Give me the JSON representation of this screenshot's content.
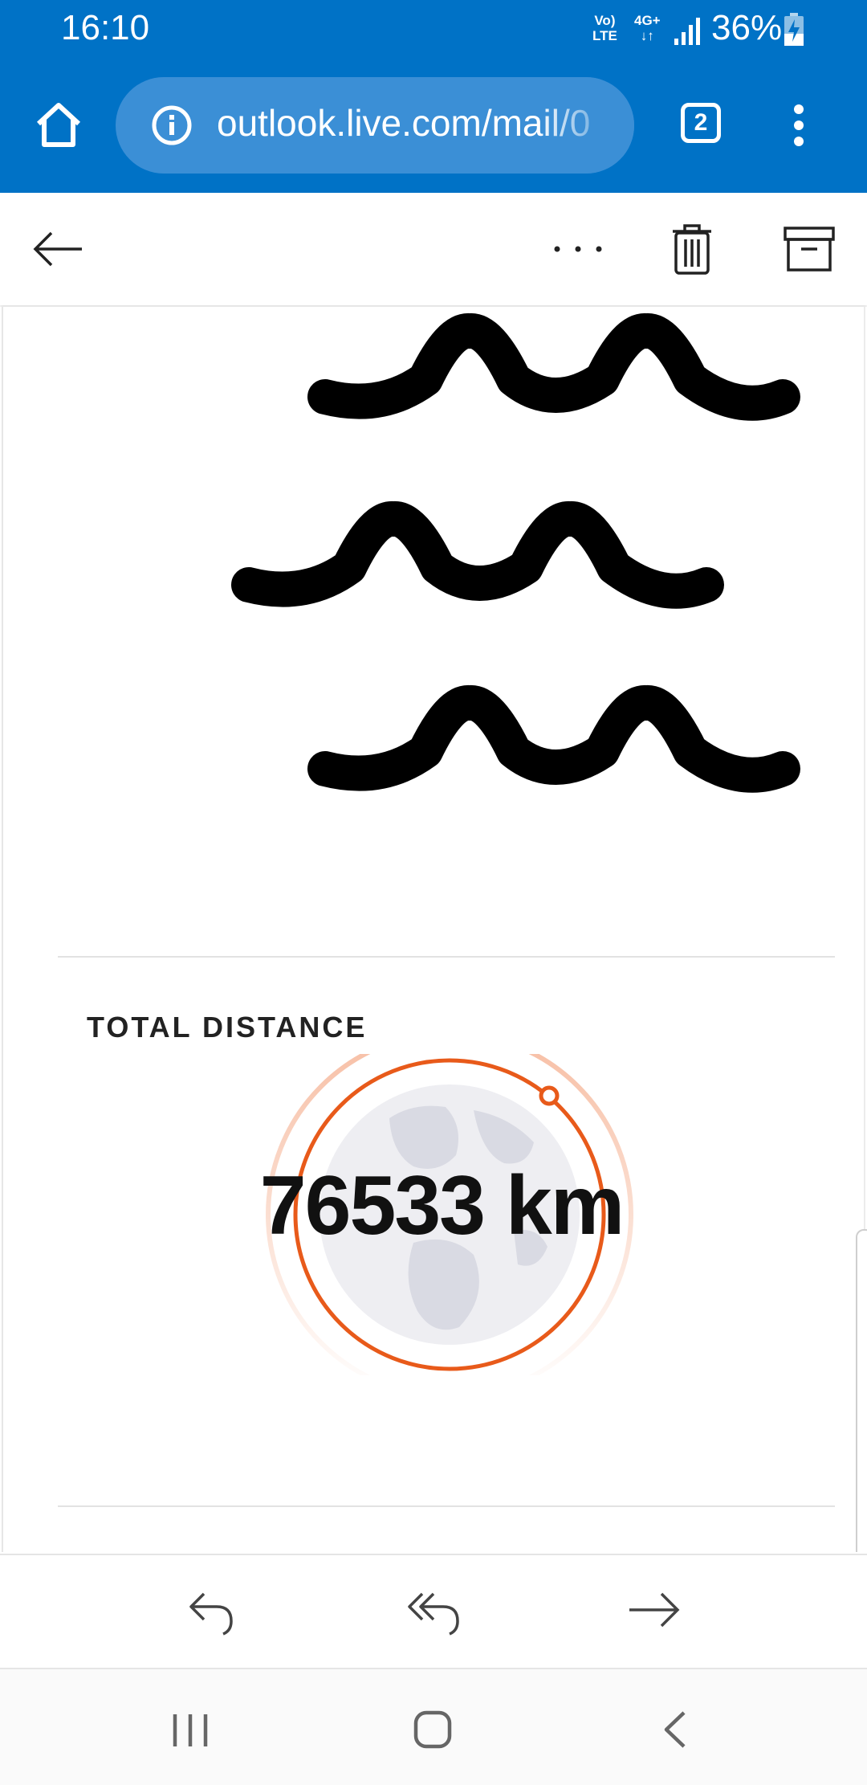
{
  "status_bar": {
    "time": "16:10",
    "network_volte_top": "Vo)",
    "network_volte_bottom": "LTE",
    "network_type_top": "4G+",
    "network_type_bottom": "↓↑",
    "battery": "36%"
  },
  "browser": {
    "url": "outlook.live.com/mail/0",
    "tab_count": "2"
  },
  "email": {
    "section_label": "TOTAL DISTANCE",
    "total_distance": "76533 km"
  },
  "colors": {
    "brand_blue": "#0072c6",
    "accent_orange": "#e85a1a"
  }
}
